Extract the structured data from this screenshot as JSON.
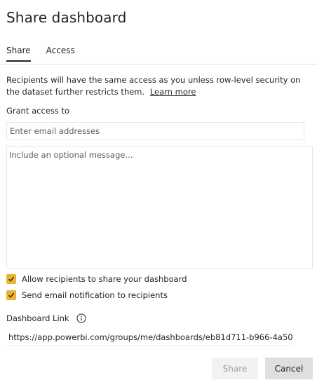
{
  "dialog": {
    "title": "Share dashboard"
  },
  "tabs": [
    {
      "label": "Share",
      "active": true
    },
    {
      "label": "Access",
      "active": false
    }
  ],
  "info": {
    "text": "Recipients will have the same access as you unless row-level security on the dataset further restricts them.",
    "learn_more": "Learn more"
  },
  "grant_access": {
    "label": "Grant access to",
    "email_placeholder": "Enter email addresses",
    "message_placeholder": "Include an optional message..."
  },
  "options": [
    {
      "label": "Allow recipients to share your dashboard",
      "checked": true
    },
    {
      "label": "Send email notification to recipients",
      "checked": true
    }
  ],
  "link": {
    "label": "Dashboard Link",
    "url": "https://app.powerbi.com/groups/me/dashboards/eb81d711-b966-4a50"
  },
  "buttons": {
    "share": "Share",
    "cancel": "Cancel"
  },
  "colors": {
    "checkbox": "#e8b430",
    "text": "#252423",
    "disabled_text": "#a19f9d"
  }
}
